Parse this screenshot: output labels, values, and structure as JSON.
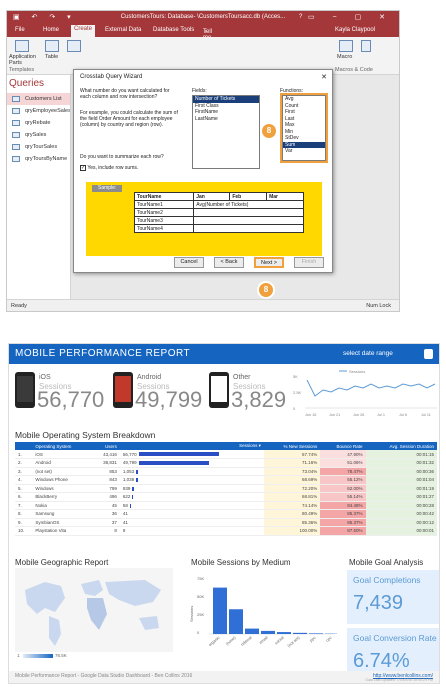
{
  "access": {
    "title": "CustomersTours: Database- \\CustomersToursacc.db (Acces...",
    "help": "?",
    "user": "Kayla Claypool",
    "tabs": [
      "File",
      "Home",
      "Create",
      "External Data",
      "Database Tools"
    ],
    "tell_me": "Tell me what you want to do...",
    "ribbon": {
      "application_parts": "Application Parts",
      "table": "Table",
      "templates": "Templates",
      "macro": "Macro",
      "macros_code": "Macros & Code"
    },
    "nav": {
      "heading": "Queries",
      "items": [
        "Customers List",
        "qryEmployeeSales",
        "qryRebate",
        "qrySales",
        "qryTourSales",
        "qryToursByName"
      ]
    },
    "wizard": {
      "title": "Crosstab Query Wizard",
      "close": "✕",
      "q1": "What number do you want calculated for each column and row intersection?",
      "example": "For example, you could calculate the sum of the field Order Amount for each employee (column) by country and region (row).",
      "q2": "Do you want to summarize each row?",
      "checkbox_label": "Yes, include row sums.",
      "fields_label": "Fields:",
      "fields": [
        "Number of Tickets",
        "First Class",
        "FirstName",
        "LastName"
      ],
      "functions_label": "Functions:",
      "functions": [
        "Avg",
        "Count",
        "First",
        "Last",
        "Max",
        "Min",
        "StDev",
        "Sum",
        "Var"
      ],
      "selected_function": "Sum",
      "sample_label": "Sample:",
      "grid_header": [
        "TourName",
        "Jan",
        "Feb",
        "Mar"
      ],
      "grid_rows": [
        "TourName1",
        "TourName2",
        "TourName3",
        "TourName4"
      ],
      "grid_cell": "Avg(Number of Tickets)",
      "buttons": {
        "cancel": "Cancel",
        "back": "< Back",
        "next": "Next >",
        "finish": "Finish"
      }
    },
    "callout_number": "8",
    "status": {
      "left": "Ready",
      "right": "Num Lock"
    }
  },
  "dashboard": {
    "title": "MOBILE PERFORMANCE REPORT",
    "date_range": "select date range",
    "devices": [
      {
        "name": "iOS",
        "metric": "Sessions",
        "value": "56,770",
        "screen": "#333333"
      },
      {
        "name": "Android",
        "metric": "Sessions",
        "value": "49,799",
        "screen": "#c0392b"
      },
      {
        "name": "Other",
        "metric": "Sessions",
        "value": "3,829",
        "screen": "#ffffff"
      }
    ],
    "sparkline": {
      "legend": "Sessions",
      "y_labels": [
        "5K",
        "2.5K",
        "0"
      ],
      "x_labels": [
        "Jun 16",
        "Jun 21",
        "Jun 26",
        "Jul 1",
        "Jul 6",
        "Jul 11"
      ]
    },
    "table_title": "Mobile Operating System Breakdown",
    "table_columns": [
      "",
      "Operating System",
      "Users",
      "Sessions ▾",
      "% New Sessions",
      "Bounce Rate",
      "Avg. Session Duration"
    ],
    "table_rows": [
      [
        "1.",
        "iOS",
        "43,416",
        "56,770",
        "67.74%",
        "47.90%",
        "00:01:15"
      ],
      [
        "2.",
        "Android",
        "38,831",
        "49,799",
        "71.16%",
        "51.06%",
        "00:01:32"
      ],
      [
        "3.",
        "(not set)",
        "853",
        "1,053",
        "73.04%",
        "78.47%",
        "00:00:36"
      ],
      [
        "4.",
        "Windows Phone",
        "843",
        "1,038",
        "68.69%",
        "55.12%",
        "00:01:04"
      ],
      [
        "5.",
        "Windows",
        "799",
        "939",
        "72.20%",
        "62.00%",
        "00:01:19"
      ],
      [
        "6.",
        "BlackBerry",
        "496",
        "622",
        "68.81%",
        "55.14%",
        "00:01:27"
      ],
      [
        "7.",
        "Nokia",
        "45",
        "58",
        "74.14%",
        "84.48%",
        "00:00:28"
      ],
      [
        "8.",
        "Samsung",
        "36",
        "41",
        "80.49%",
        "85.37%",
        "00:00:42"
      ],
      [
        "9.",
        "SymbianOS",
        "37",
        "41",
        "85.36%",
        "85.37%",
        "00:00:12"
      ],
      [
        "10.",
        "Playstation Vita",
        "8",
        "8",
        "100.00%",
        "87.50%",
        "00:00:01"
      ]
    ],
    "geo_title": "Mobile Geographic Report",
    "geo_scale": [
      "1",
      "76.5K"
    ],
    "medium_title": "Mobile Sessions by Medium",
    "medium_ylabel": "Sessions",
    "medium_y": [
      "75K",
      "50K",
      "25K",
      "0"
    ],
    "medium_categories": [
      "organic",
      "(none)",
      "referral",
      "email",
      "social",
      "(not set)",
      "ppc",
      "cpc"
    ],
    "goal_title": "Mobile Goal Analysis",
    "kpis": [
      {
        "label": "Goal Completions",
        "value": "7,439"
      },
      {
        "label": "Goal Conversion Rate",
        "value": "6.74%"
      }
    ],
    "footer_left": "Mobile Performance Report - Google Data Studio Dashboard - Ben Collins 2016",
    "footer_link": "http://www.benlcollins.com/",
    "footer_updated": "Data Last Updated: 7/19/2016 10:00:29 PM"
  },
  "chart_data": {
    "type": "bar",
    "title": "Mobile Sessions by Medium",
    "categories": [
      "organic",
      "(none)",
      "referral",
      "email",
      "social",
      "(not set)",
      "ppc",
      "cpc"
    ],
    "values": [
      60000,
      32000,
      7000,
      4000,
      2500,
      1500,
      800,
      400
    ],
    "ylabel": "Sessions",
    "ylim": [
      0,
      75000
    ]
  }
}
